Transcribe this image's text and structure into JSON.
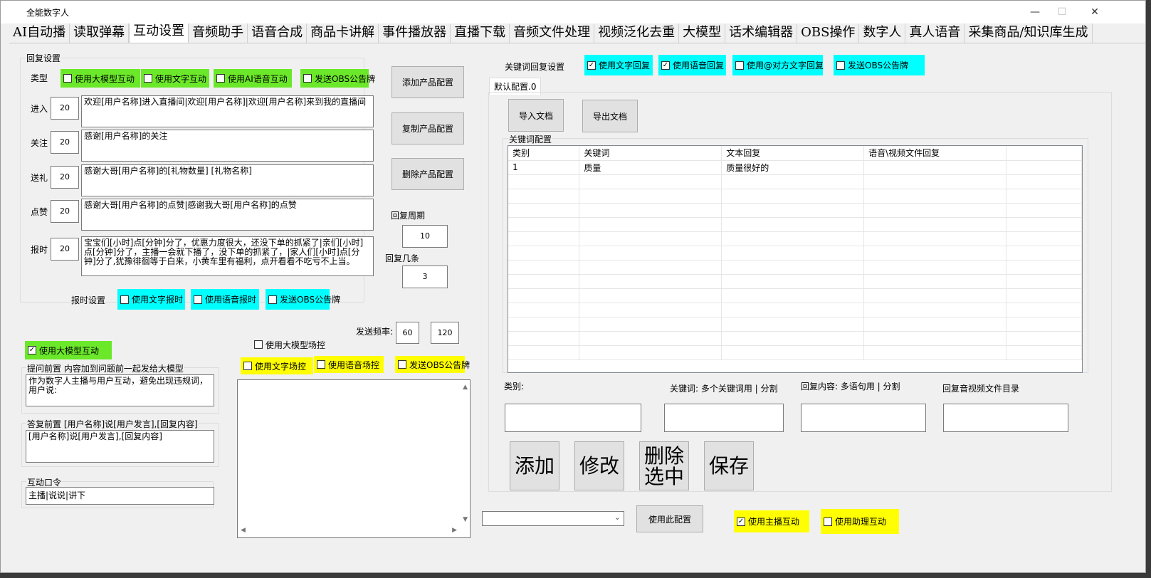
{
  "window": {
    "title": "全能数字人",
    "minimize": "—",
    "maximize": "☐",
    "close": "✕"
  },
  "tabs": [
    "AI自动播",
    "读取弹幕",
    "互动设置",
    "音频助手",
    "语音合成",
    "商品卡讲解",
    "事件播放器",
    "直播下载",
    "音频文件处理",
    "视频泛化去重",
    "大模型",
    "话术编辑器",
    "OBS操作",
    "数字人",
    "真人语音",
    "采集商品/知识库生成"
  ],
  "reply_settings": {
    "legend": "回复设置",
    "type_label": "类型",
    "type_checks": [
      {
        "label": "使用大模型互动",
        "checked": false
      },
      {
        "label": "使用文字互动",
        "checked": false
      },
      {
        "label": "使用AI语音互动",
        "checked": false
      },
      {
        "label": "发送OBS公告牌",
        "checked": false
      }
    ],
    "rows": [
      {
        "label": "进入",
        "num": "20",
        "text": "欢迎[用户名称]进入直播间|欢迎[用户名称]|欢迎[用户名称]来到我的直播间"
      },
      {
        "label": "关注",
        "num": "20",
        "text": "感谢[用户名称]的关注"
      },
      {
        "label": "送礼",
        "num": "20",
        "text": "感谢大哥[用户名称]的[礼物数量] [礼物名称]"
      },
      {
        "label": "点赞",
        "num": "20",
        "text": "感谢大哥[用户名称]的点赞|感谢我大哥[用户名称]的点赞"
      },
      {
        "label": "报时",
        "num": "20",
        "text": "宝宝们[小时]点[分钟]分了，优惠力度很大，还没下单的抓紧了|亲们[小时]点[分钟]分了，主播一会就下播了，没下单的抓紧了，|家人们[小时]点[分钟]分了,犹豫徘徊等于白来，小黄车里有福利，点开看看不吃亏不上当。"
      }
    ],
    "time_label": "报时设置",
    "time_checks": [
      {
        "label": "使用文字报时",
        "checked": false
      },
      {
        "label": "使用语音报时",
        "checked": false
      },
      {
        "label": "发送OBS公告牌",
        "checked": false
      }
    ]
  },
  "product_buttons": {
    "add": "添加产品配置",
    "copy": "复制产品配置",
    "delete": "删除产品配置"
  },
  "cycle": {
    "period_label": "回复周期",
    "period_value": "10",
    "count_label": "回复几条",
    "count_value": "3"
  },
  "frequency": {
    "label": "发送频率:",
    "min": "60",
    "max": "120"
  },
  "llm": {
    "enable_label": "使用大模型互动",
    "enable_checked": true,
    "prefix_legend": "提问前置  内容加到问题前一起发给大模型",
    "prefix_text": "作为数字人主播与用户互动，避免出现违规词，用户说:",
    "answer_legend": "答复前置  [用户名称]说[用户发言],[回复内容]",
    "answer_text": "[用户名称]说[用户发言],[回复内容]",
    "command_legend": "互动口令",
    "command_text": "主播|说说|讲下"
  },
  "field_control": {
    "label": "使用大模型场控",
    "checked": false,
    "checks": [
      {
        "label": "使用文字场控",
        "checked": false
      },
      {
        "label": "使用语音场控",
        "checked": false
      },
      {
        "label": "发送OBS公告牌",
        "checked": false
      }
    ]
  },
  "keyword_reply": {
    "label": "关键词回复设置",
    "checks": [
      {
        "label": "使用文字回复",
        "checked": true
      },
      {
        "label": "使用语音回复",
        "checked": true
      },
      {
        "label": "使用@对方文字回复",
        "checked": false
      },
      {
        "label": "发送OBS公告牌",
        "checked": false
      }
    ],
    "tab": "默认配置.0",
    "import": "导入文档",
    "export": "导出文档",
    "config_legend": "关键词配置",
    "columns": [
      "类别",
      "关键词",
      "文本回复",
      "语音\\视频文件回复"
    ],
    "rows": [
      [
        "1",
        "质量",
        "质量很好的",
        ""
      ]
    ],
    "field_labels": {
      "category": "类别:",
      "keyword": "关键词: 多个关键词用 | 分割",
      "reply": "回复内容: 多语句用 | 分割",
      "audio_dir": "回复音视频文件目录"
    },
    "buttons": {
      "add": "添加",
      "modify": "修改",
      "delete": "删除选中",
      "save": "保存"
    }
  },
  "bottom": {
    "use_config": "使用此配置",
    "host_interact": {
      "label": "使用主播互动",
      "checked": true
    },
    "assistant_interact": {
      "label": "使用助理互动",
      "checked": false
    }
  },
  "colors": {
    "green": "#6be82a",
    "cyan": "#00ffff",
    "yellow": "#ffff00"
  }
}
